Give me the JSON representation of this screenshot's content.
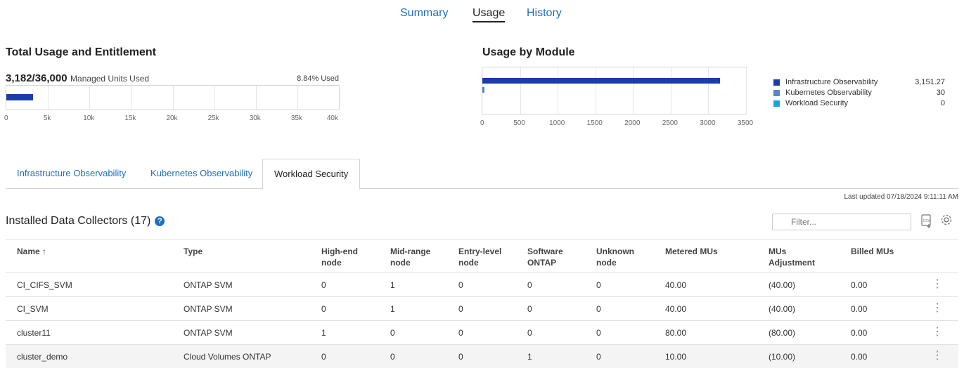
{
  "top_tabs": [
    "Summary",
    "Usage",
    "History"
  ],
  "total_usage": {
    "title": "Total Usage and Entitlement",
    "headline_value": "3,182/36,000",
    "headline_suffix": "Managed Units Used",
    "percent_used": "8.84% Used",
    "bar_value": 3182,
    "axis_ticks": [
      "0",
      "5k",
      "10k",
      "15k",
      "20k",
      "25k",
      "30k",
      "35k",
      "40k"
    ],
    "axis_max": 40000,
    "bar_color": "#1a3ea8"
  },
  "usage_by_module": {
    "title": "Usage by Module",
    "axis_ticks": [
      "0",
      "500",
      "1000",
      "1500",
      "2000",
      "2500",
      "3000",
      "3500"
    ],
    "legend": [
      {
        "label": "Infrastructure Observability",
        "value": "3,151.27",
        "color": "#1a3ea8"
      },
      {
        "label": "Kubernetes Observability",
        "value": "30",
        "color": "#5b86c5"
      },
      {
        "label": "Workload Security",
        "value": "0",
        "color": "#1aa3e0"
      }
    ]
  },
  "chart_data": [
    {
      "type": "bar",
      "title": "Total Usage and Entitlement",
      "categories": [
        "Managed Units Used"
      ],
      "values": [
        3182
      ],
      "xlim": [
        0,
        40000
      ],
      "orientation": "horizontal"
    },
    {
      "type": "bar",
      "title": "Usage by Module",
      "orientation": "horizontal",
      "categories": [
        "Infrastructure Observability",
        "Kubernetes Observability",
        "Workload Security"
      ],
      "values": [
        3151.27,
        30,
        0
      ],
      "xlim": [
        0,
        3500
      ]
    }
  ],
  "module_tabs": [
    "Infrastructure Observability",
    "Kubernetes Observability",
    "Workload Security"
  ],
  "last_updated": "Last updated 07/18/2024 9:11:11 AM",
  "collectors": {
    "title": "Installed Data Collectors (17)",
    "filter_placeholder": "Filter...",
    "columns": [
      "Name",
      "Type",
      "High-end node",
      "Mid-range node",
      "Entry-level node",
      "Software ONTAP",
      "Unknown node",
      "Metered MUs",
      "MUs Adjustment",
      "Billed MUs"
    ],
    "column_lines": [
      [
        "Name ↑"
      ],
      [
        "Type"
      ],
      [
        "High-end",
        "node"
      ],
      [
        "Mid-range",
        "node"
      ],
      [
        "Entry-level",
        "node"
      ],
      [
        "Software",
        "ONTAP"
      ],
      [
        "Unknown",
        "node"
      ],
      [
        "Metered MUs"
      ],
      [
        "MUs",
        "Adjustment"
      ],
      [
        "Billed MUs"
      ]
    ],
    "rows": [
      [
        "CI_CIFS_SVM",
        "ONTAP SVM",
        "0",
        "1",
        "0",
        "0",
        "0",
        "40.00",
        "(40.00)",
        "0.00"
      ],
      [
        "CI_SVM",
        "ONTAP SVM",
        "0",
        "1",
        "0",
        "0",
        "0",
        "40.00",
        "(40.00)",
        "0.00"
      ],
      [
        "cluster11",
        "ONTAP SVM",
        "1",
        "0",
        "0",
        "0",
        "0",
        "80.00",
        "(80.00)",
        "0.00"
      ],
      [
        "cluster_demo",
        "Cloud Volumes ONTAP",
        "0",
        "0",
        "0",
        "1",
        "0",
        "10.00",
        "(10.00)",
        "0.00"
      ]
    ]
  }
}
